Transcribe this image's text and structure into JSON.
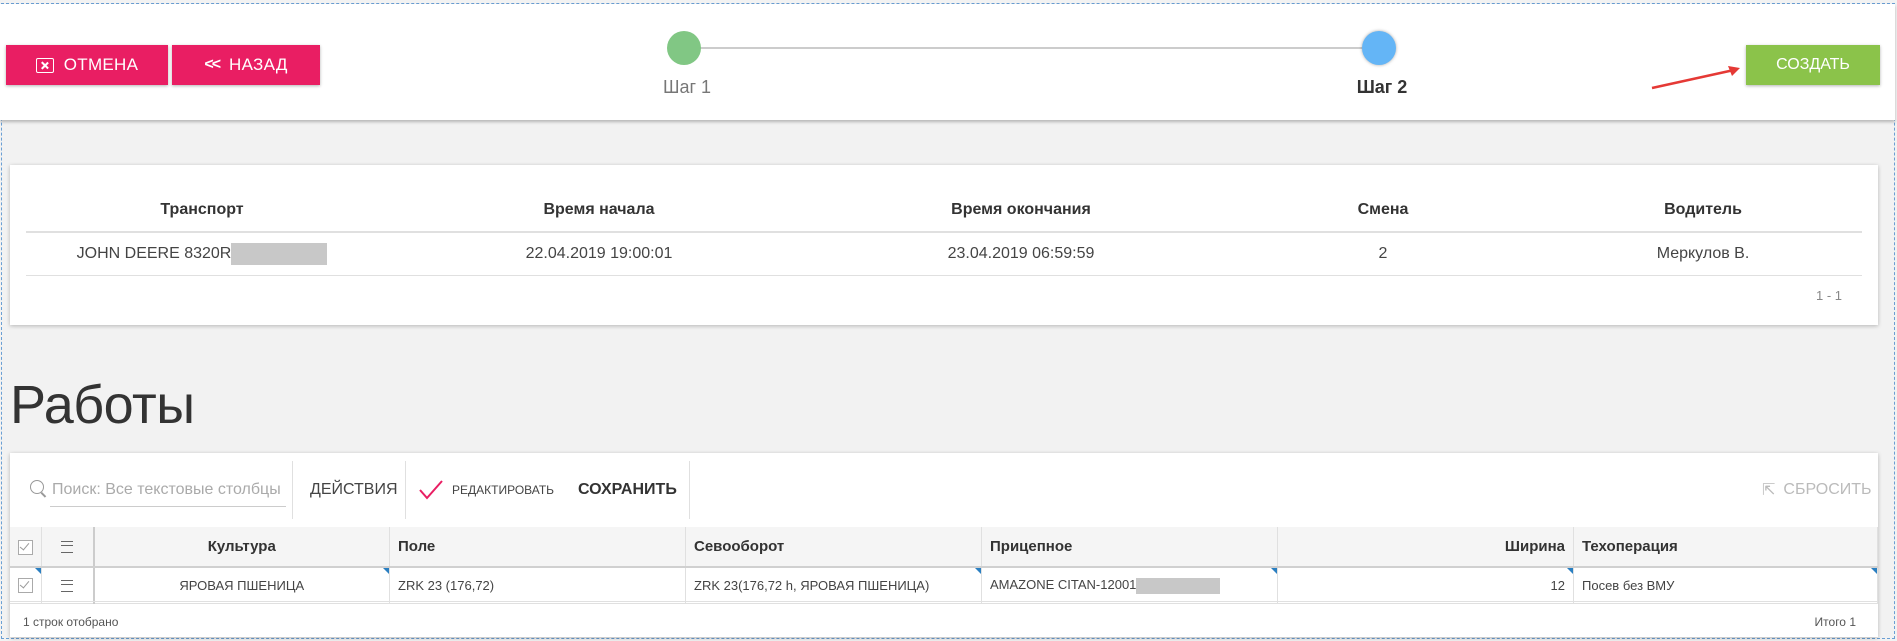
{
  "header": {
    "cancel_label": "Отмена",
    "back_label": "Назад",
    "create_label": "Создать",
    "steps": [
      {
        "label": "Шаг 1",
        "color": "#81c784"
      },
      {
        "label": "Шаг 2",
        "color": "#64b5f6",
        "active": true
      }
    ]
  },
  "colors": {
    "pink": "#e91e63",
    "green": "#8bc34a",
    "arrow": "#e53935"
  },
  "summary_table": {
    "columns": [
      "Транспорт",
      "Время начала",
      "Время окончания",
      "Смена",
      "Водитель"
    ],
    "rows": [
      {
        "transport": "JOHN DEERE 8320R",
        "start": "22.04.2019 19:00:01",
        "end": "23.04.2019 06:59:59",
        "shift": "2",
        "driver": "Меркулов В."
      }
    ],
    "pager": "1 - 1"
  },
  "works": {
    "title": "Работы",
    "toolbar": {
      "search_placeholder": "Поиск: Все текстовые столбцы",
      "actions_label": "Действия",
      "edit_label": "Редактировать",
      "save_label": "Сохранить",
      "reset_label": "Сбросить"
    },
    "columns": [
      "Культура",
      "Поле",
      "Севооборот",
      "Прицепное",
      "Ширина",
      "Техоперация"
    ],
    "rows": [
      {
        "culture": "ЯРОВАЯ ПШЕНИЦА",
        "field": "ZRK 23 (176,72)",
        "rotation": "ZRK 23(176,72 h, ЯРОВАЯ ПШЕНИЦА)",
        "trailer": "AMAZONE CITAN-12001",
        "width": "12",
        "operation": "Посев без ВМУ"
      }
    ],
    "footer_left": "1 строк отобрано",
    "footer_right": "Итого 1"
  }
}
